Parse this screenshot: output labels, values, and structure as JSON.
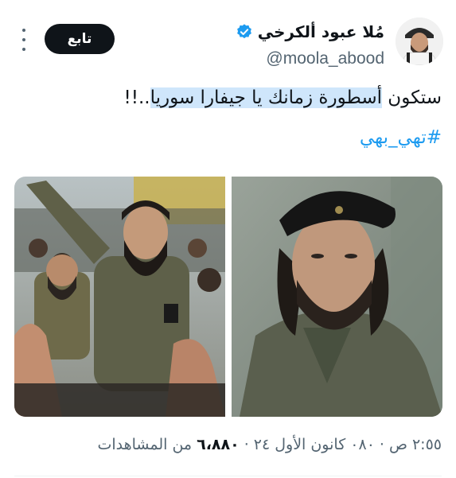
{
  "author": {
    "display_name": "مُلا عبود ألكرخي",
    "handle": "@moola_abood",
    "verified": true,
    "avatar_icon": "profile-photo"
  },
  "actions": {
    "follow_label": "تابع",
    "more_icon": "more-vertical-icon"
  },
  "tweet": {
    "text_prefix": "ستكون ",
    "text_highlighted": "أسطورة زمانك يا جيفارا سوريا",
    "text_suffix": "..!!",
    "hashtag": "#تهي_بهي",
    "highlight_color": "#cfe6fb"
  },
  "media": [
    {
      "name": "left-photo"
    },
    {
      "name": "right-photo"
    }
  ],
  "meta": {
    "time": "٢:٥٥ ص",
    "date": "٠٨٠ كانون الأول ٢٤",
    "views": "٦،٨٨٠",
    "views_label": "من المشاهدات",
    "separator": "·"
  },
  "colors": {
    "accent": "#1d9bf0",
    "text": "#0f1419",
    "muted": "#536471",
    "button_bg": "#0f1419"
  }
}
